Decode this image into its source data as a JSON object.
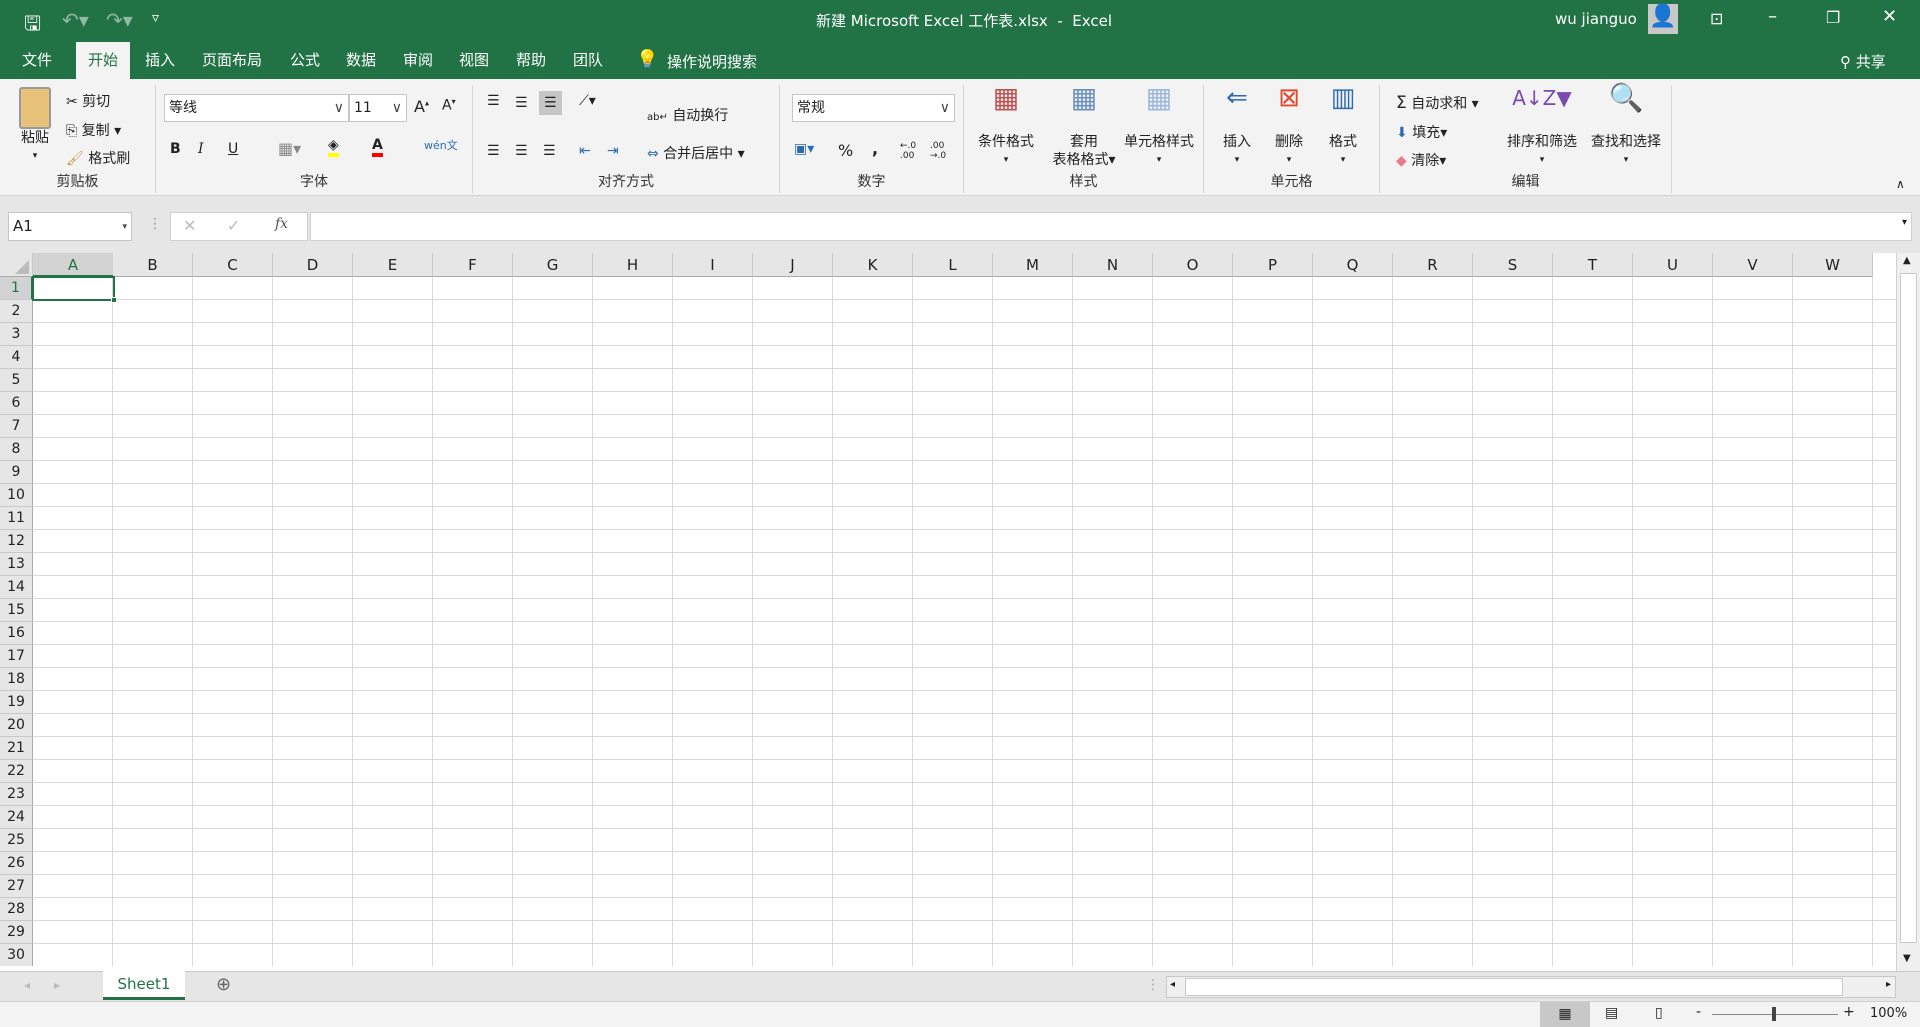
{
  "titlebar": {
    "title": "新建 Microsoft Excel 工作表.xlsx  -  Excel",
    "user": "wu jianguo",
    "save_icon": "save-icon",
    "undo_icon": "undo-icon",
    "redo_icon": "redo-icon"
  },
  "tabs": [
    {
      "label": "文件"
    },
    {
      "label": "开始",
      "active": true
    },
    {
      "label": "插入"
    },
    {
      "label": "页面布局"
    },
    {
      "label": "公式"
    },
    {
      "label": "数据"
    },
    {
      "label": "审阅"
    },
    {
      "label": "视图"
    },
    {
      "label": "帮助"
    },
    {
      "label": "团队"
    }
  ],
  "tell_me": "操作说明搜索",
  "share": "共享",
  "clipboard": {
    "paste": "粘贴",
    "cut": "剪切",
    "copy": "复制",
    "format_painter": "格式刷",
    "label": "剪贴板"
  },
  "font": {
    "name": "等线",
    "size": "11",
    "bold": "B",
    "italic": "I",
    "underline": "U",
    "label": "字体",
    "phonetic": "wén文"
  },
  "alignment": {
    "wrap": "自动换行",
    "merge": "合并后居中",
    "label": "对齐方式"
  },
  "number": {
    "format": "常规",
    "percent": "%",
    "comma": ",",
    "inc": "←.0 .00",
    "dec": ".00 →.0",
    "label": "数字"
  },
  "styles": {
    "conditional": "条件格式",
    "table": "套用",
    "table2": "表格格式",
    "cell": "单元格样式",
    "label": "样式"
  },
  "cells": {
    "insert": "插入",
    "delete": "删除",
    "format": "格式",
    "label": "单元格"
  },
  "editing": {
    "autosum": "自动求和",
    "fill": "填充",
    "clear": "清除",
    "sort": "排序和筛选",
    "find": "查找和选择",
    "label": "编辑"
  },
  "formula_bar": {
    "name_box": "A1",
    "fx": "fx",
    "value": ""
  },
  "columns": [
    "A",
    "B",
    "C",
    "D",
    "E",
    "F",
    "G",
    "H",
    "I",
    "J",
    "K",
    "L",
    "M",
    "N",
    "O",
    "P",
    "Q",
    "R",
    "S",
    "T",
    "U",
    "V",
    "W"
  ],
  "rows": [
    "1",
    "2",
    "3",
    "4",
    "5",
    "6",
    "7",
    "8",
    "9",
    "10",
    "11",
    "12",
    "13",
    "14",
    "15",
    "16",
    "17",
    "18",
    "19",
    "20",
    "21",
    "22",
    "23",
    "24",
    "25",
    "26",
    "27",
    "28",
    "29",
    "30"
  ],
  "sheets": [
    {
      "name": "Sheet1",
      "active": true
    }
  ],
  "status": {
    "zoom": "100%"
  },
  "accent": "#217346"
}
